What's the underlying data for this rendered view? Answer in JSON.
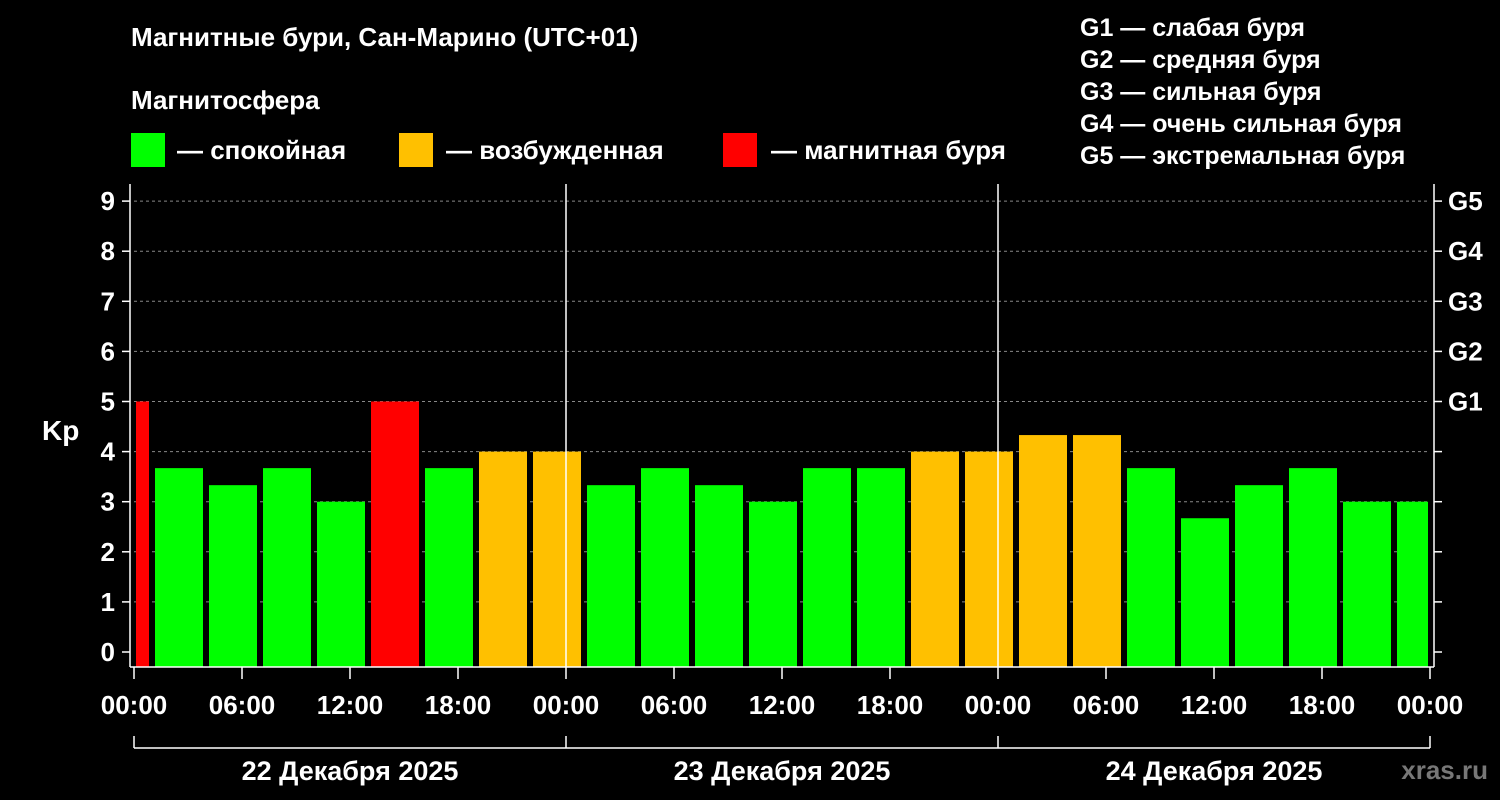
{
  "title": "Магнитные бури, Сан-Марино (UTC+01)",
  "legend": {
    "title": "Магнитосфера",
    "items": [
      {
        "label": "— спокойная",
        "color": "#00ff00"
      },
      {
        "label": "— возбужденная",
        "color": "#ffc000"
      },
      {
        "label": "— магнитная буря",
        "color": "#ff0000"
      }
    ]
  },
  "g_scale": [
    "G1 — слабая буря",
    "G2 — средняя буря",
    "G3 — сильная буря",
    "G4 — очень сильная буря",
    "G5 — экстремальная буря"
  ],
  "watermark": "xras.ru",
  "chart_data": {
    "type": "bar",
    "ylabel": "Kp",
    "ylim": [
      0,
      9
    ],
    "yticks": [
      0,
      1,
      2,
      3,
      4,
      5,
      6,
      7,
      8,
      9
    ],
    "right_axis_labels": [
      {
        "kp": 5,
        "label": "G1"
      },
      {
        "kp": 6,
        "label": "G2"
      },
      {
        "kp": 7,
        "label": "G3"
      },
      {
        "kp": 8,
        "label": "G4"
      },
      {
        "kp": 9,
        "label": "G5"
      }
    ],
    "x_tick_labels": [
      "00:00",
      "06:00",
      "12:00",
      "18:00",
      "00:00",
      "06:00",
      "12:00",
      "18:00",
      "00:00",
      "06:00",
      "12:00",
      "18:00",
      "00:00"
    ],
    "days": [
      "22 Декабря 2025",
      "23 Декабря 2025",
      "24 Декабря 2025"
    ],
    "grid": true,
    "colors": {
      "quiet": "#00ff00",
      "active": "#ffc000",
      "storm": "#ff0000"
    },
    "bars": [
      {
        "start_hour": 0,
        "end_hour": 1,
        "kp": 5.0,
        "state": "storm"
      },
      {
        "start_hour": 1,
        "end_hour": 4,
        "kp": 3.67,
        "state": "quiet"
      },
      {
        "start_hour": 4,
        "end_hour": 7,
        "kp": 3.33,
        "state": "quiet"
      },
      {
        "start_hour": 7,
        "end_hour": 10,
        "kp": 3.67,
        "state": "quiet"
      },
      {
        "start_hour": 10,
        "end_hour": 13,
        "kp": 3.0,
        "state": "quiet"
      },
      {
        "start_hour": 13,
        "end_hour": 16,
        "kp": 5.0,
        "state": "storm"
      },
      {
        "start_hour": 16,
        "end_hour": 19,
        "kp": 3.67,
        "state": "quiet"
      },
      {
        "start_hour": 19,
        "end_hour": 22,
        "kp": 4.0,
        "state": "active"
      },
      {
        "start_hour": 22,
        "end_hour": 25,
        "kp": 4.0,
        "state": "active"
      },
      {
        "start_hour": 25,
        "end_hour": 28,
        "kp": 3.33,
        "state": "quiet"
      },
      {
        "start_hour": 28,
        "end_hour": 31,
        "kp": 3.67,
        "state": "quiet"
      },
      {
        "start_hour": 31,
        "end_hour": 34,
        "kp": 3.33,
        "state": "quiet"
      },
      {
        "start_hour": 34,
        "end_hour": 37,
        "kp": 3.0,
        "state": "quiet"
      },
      {
        "start_hour": 37,
        "end_hour": 40,
        "kp": 3.67,
        "state": "quiet"
      },
      {
        "start_hour": 40,
        "end_hour": 43,
        "kp": 3.67,
        "state": "quiet"
      },
      {
        "start_hour": 43,
        "end_hour": 46,
        "kp": 4.0,
        "state": "active"
      },
      {
        "start_hour": 46,
        "end_hour": 49,
        "kp": 4.0,
        "state": "active"
      },
      {
        "start_hour": 49,
        "end_hour": 52,
        "kp": 4.33,
        "state": "active"
      },
      {
        "start_hour": 52,
        "end_hour": 55,
        "kp": 4.33,
        "state": "active"
      },
      {
        "start_hour": 55,
        "end_hour": 58,
        "kp": 3.67,
        "state": "quiet"
      },
      {
        "start_hour": 58,
        "end_hour": 61,
        "kp": 2.67,
        "state": "quiet"
      },
      {
        "start_hour": 61,
        "end_hour": 64,
        "kp": 3.33,
        "state": "quiet"
      },
      {
        "start_hour": 64,
        "end_hour": 67,
        "kp": 3.67,
        "state": "quiet"
      },
      {
        "start_hour": 67,
        "end_hour": 70,
        "kp": 3.0,
        "state": "quiet"
      },
      {
        "start_hour": 70,
        "end_hour": 72,
        "kp": 3.0,
        "state": "quiet"
      }
    ]
  }
}
